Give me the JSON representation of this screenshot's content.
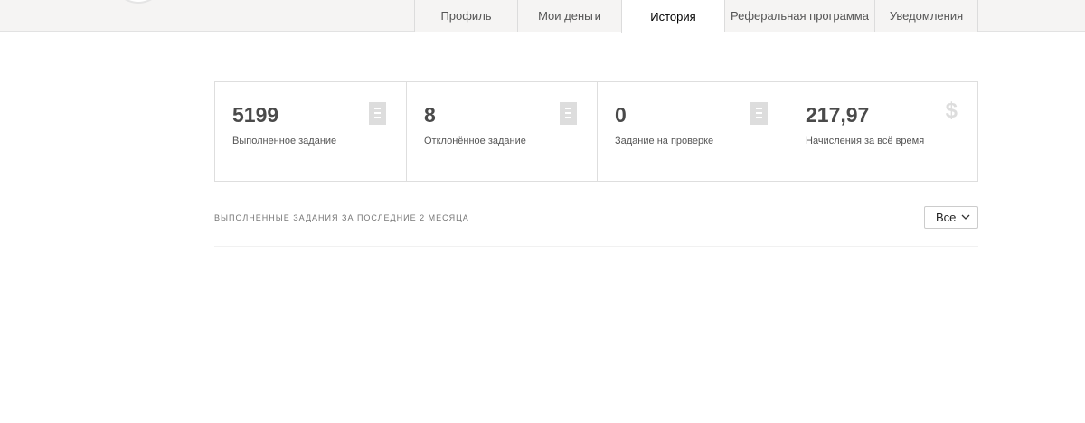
{
  "tabs": [
    {
      "label": "Профиль",
      "active": false
    },
    {
      "label": "Мои деньги",
      "active": false
    },
    {
      "label": "История",
      "active": true
    },
    {
      "label": "Реферальная программа",
      "active": false
    },
    {
      "label": "Уведомления",
      "active": false
    }
  ],
  "stats": [
    {
      "value": "5199",
      "label": "Выполненное задание",
      "icon": "document-icon"
    },
    {
      "value": "8",
      "label": "Отклонённое задание",
      "icon": "document-icon"
    },
    {
      "value": "0",
      "label": "Задание на проверке",
      "icon": "document-icon"
    },
    {
      "value": "217,97",
      "label": "Начисления за всё время",
      "icon": "dollar-icon",
      "icon_glyph": "$"
    }
  ],
  "history": {
    "title": "ВЫПОЛНЕННЫЕ ЗАДАНИЯ ЗА ПОСЛЕДНИЕ 2 МЕСЯЦА",
    "filter_value": "Все"
  },
  "colors": {
    "topbar_bg": "#f5f4f3",
    "icon_gray": "#dddddd",
    "value_text": "#4a4a4a"
  }
}
